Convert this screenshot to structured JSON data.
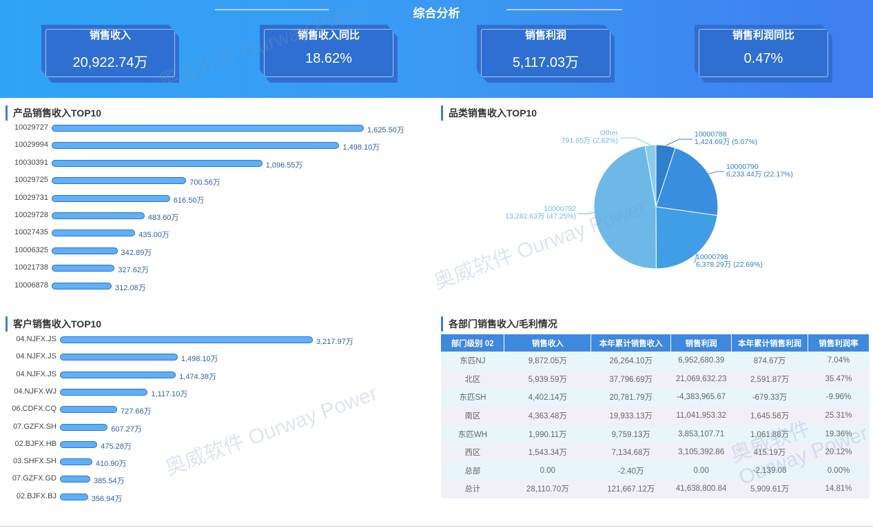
{
  "header": {
    "title": "综合分析"
  },
  "kpis": [
    {
      "label": "销售收入",
      "value": "20,922.74万"
    },
    {
      "label": "销售收入同比",
      "value": "18.62%"
    },
    {
      "label": "销售利润",
      "value": "5,117.03万"
    },
    {
      "label": "销售利润同比",
      "value": "0.47%"
    }
  ],
  "watermark": "奥威软件 Ourway Power",
  "chart_data": [
    {
      "type": "bar",
      "title": "产品销售收入TOP10",
      "orientation": "horizontal",
      "unit": "万",
      "categories": [
        "10029727",
        "10029994",
        "10030391",
        "10029725",
        "10029731",
        "10029728",
        "10027435",
        "10006325",
        "10021738",
        "10006878"
      ],
      "values": [
        1625.5,
        1498.1,
        1096.55,
        700.56,
        616.5,
        483.6,
        435.0,
        342.89,
        327.62,
        312.08
      ],
      "labels": [
        "1,625.50万",
        "1,498.10万",
        "1,096.55万",
        "700.56万",
        "616.50万",
        "483.60万",
        "435.00万",
        "342.89万",
        "327.62万",
        "312.08万"
      ]
    },
    {
      "type": "pie",
      "title": "品类销售收入TOP10",
      "slices": [
        {
          "name": "10000788",
          "value": 1424.69,
          "label": "1,424.69万 (5.07%)",
          "percent": 5.07,
          "color": "#2f7fcd"
        },
        {
          "name": "10000790",
          "value": 6233.44,
          "label": "6,233.44万 (22.17%)",
          "percent": 22.17,
          "color": "#3a8ee0"
        },
        {
          "name": "10000798",
          "value": 6378.29,
          "label": "6,378.29万 (22.69%)",
          "percent": 22.69,
          "color": "#3f9ee6"
        },
        {
          "name": "10000792",
          "value": 13282.63,
          "label": "13,282.63万 (47.25%)",
          "percent": 47.25,
          "color": "#6db8e6"
        },
        {
          "name": "Other",
          "value": 791.65,
          "label": "791.65万 (2.82%)",
          "percent": 2.82,
          "color": "#8ccaf0"
        }
      ]
    },
    {
      "type": "bar",
      "title": "客户销售收入TOP10",
      "orientation": "horizontal",
      "unit": "万",
      "categories": [
        "04.NJFX.JS",
        "04.NJFX.JS",
        "04.NJFX.JS",
        "04.NJFX.WJ",
        "06.CDFX.CQ",
        "07.GZFX.SH",
        "02.BJFX.HB",
        "03.SHFX.SH",
        "07.GZFX.GD",
        "02.BJFX.BJ"
      ],
      "values": [
        3217.97,
        1498.1,
        1474.38,
        1117.1,
        727.66,
        607.27,
        475.28,
        410.9,
        385.54,
        356.94
      ],
      "labels": [
        "3,217.97万",
        "1,498.10万",
        "1,474.38万",
        "1,117.10万",
        "727.66万",
        "607.27万",
        "475.28万",
        "410.90万",
        "385.54万",
        "356.94万"
      ]
    }
  ],
  "table": {
    "title": "各部门销售收入/毛利情况",
    "headers": [
      "部门级别 02",
      "销售收入",
      "本年累计销售收入",
      "销售利润",
      "本年累计销售利润",
      "销售利润率"
    ],
    "rows": [
      [
        "东匹NJ",
        "9,872.05万",
        "26,264.10万",
        "6,952,680.39",
        "874.67万",
        "7.04%"
      ],
      [
        "北区",
        "5,939.59万",
        "37,796.69万",
        "21,069,632.23",
        "2,591.87万",
        "35.47%"
      ],
      [
        "东匹SH",
        "4,402.14万",
        "20,781.79万",
        "-4,383,965.67",
        "-679.33万",
        "-9.96%"
      ],
      [
        "南区",
        "4,363.48万",
        "19,933.13万",
        "11,041,953.32",
        "1,645.56万",
        "25.31%"
      ],
      [
        "东匹WH",
        "1,990.11万",
        "9,759.13万",
        "3,853,107.71",
        "1,061.88万",
        "19.36%"
      ],
      [
        "西区",
        "1,543.34万",
        "7,134.68万",
        "3,105,392.86",
        "415.19万",
        "20.12%"
      ],
      [
        "总部",
        "0.00",
        "-2.40万",
        "0.00",
        "-2,139.08",
        "0.00%"
      ],
      [
        "总计",
        "28,110.70万",
        "121,667.12万",
        "41,638,800.84",
        "5,909.61万",
        "14.81%"
      ]
    ]
  }
}
